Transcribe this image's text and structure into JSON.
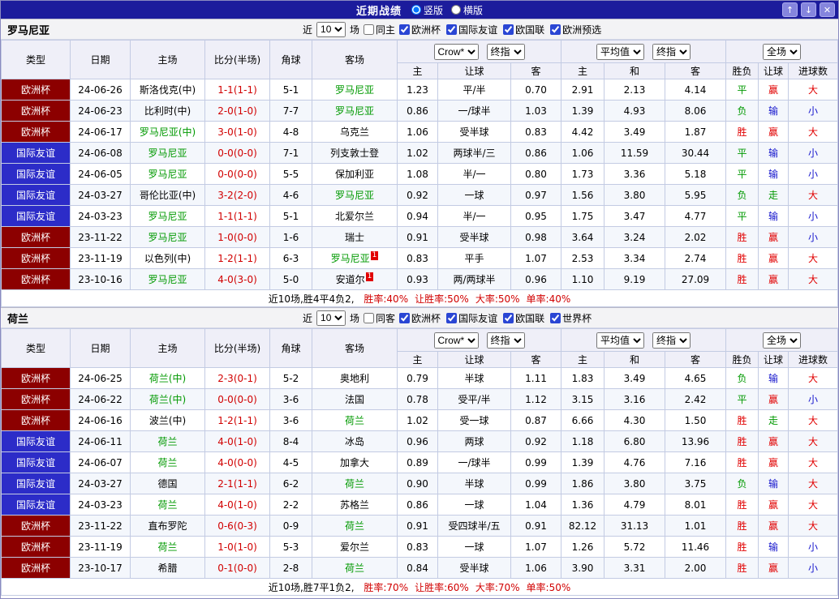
{
  "titlebar": {
    "title": "近期战绩",
    "layout_options": [
      {
        "label": "竖版",
        "selected": true
      },
      {
        "label": "横版",
        "selected": false
      }
    ],
    "buttons": {
      "up": "↑",
      "down": "↓",
      "close": "✕"
    }
  },
  "colors": {
    "titlebar_bg": "#1C1C9C",
    "euro_league_bg": "#8C0000",
    "friendly_league_bg": "#2C2CC8",
    "team_highlight": "#009900",
    "score_red": "#D10000",
    "win_red": "#E10000",
    "draw_green": "#009900",
    "lose_blue": "#1414CC"
  },
  "table_header": {
    "type": "类型",
    "date": "日期",
    "home": "主场",
    "score": "比分(半场)",
    "corners": "角球",
    "away": "客场",
    "bookmaker_select": "Crow*",
    "final_select": "终指",
    "average_select": "平均值",
    "fulltime_select": "全场",
    "sub": {
      "home": "主",
      "handicap": "让球",
      "away": "客",
      "home2": "主",
      "draw": "和",
      "away2": "客",
      "result": "胜负",
      "handicap_result": "让球",
      "goals": "进球数"
    }
  },
  "league_styles": {
    "欧洲杯": "league-euro",
    "国际友谊": "league-friend"
  },
  "result_colors": {
    "胜": "c-red",
    "平": "c-green",
    "负": "c-green",
    "赢": "c-red",
    "输": "c-blue",
    "走": "c-green",
    "大": "c-red",
    "小": "c-blue"
  },
  "teams": [
    {
      "name": "罗马尼亚",
      "filters": {
        "recent": "近",
        "count": "10",
        "matches": "场",
        "venue": {
          "label": "同主",
          "checked": false
        },
        "leagues": [
          {
            "label": "欧洲杯",
            "checked": true
          },
          {
            "label": "国际友谊",
            "checked": true
          },
          {
            "label": "欧国联",
            "checked": true
          },
          {
            "label": "欧洲预选",
            "checked": true
          }
        ]
      },
      "rows": [
        {
          "league": "欧洲杯",
          "date": "24-06-26",
          "home": "斯洛伐克(中)",
          "home_team": false,
          "home_badge": "",
          "score": "1-1(1-1)",
          "corners": "5-1",
          "away": "罗马尼亚",
          "away_team": true,
          "away_badge": "",
          "crow": [
            "1.23",
            "平/半",
            "0.70"
          ],
          "avg": [
            "2.91",
            "2.13",
            "4.14"
          ],
          "results": [
            "平",
            "赢",
            "大"
          ]
        },
        {
          "league": "欧洲杯",
          "date": "24-06-23",
          "home": "比利时(中)",
          "home_team": false,
          "home_badge": "",
          "score": "2-0(1-0)",
          "corners": "7-7",
          "away": "罗马尼亚",
          "away_team": true,
          "away_badge": "",
          "crow": [
            "0.86",
            "一/球半",
            "1.03"
          ],
          "avg": [
            "1.39",
            "4.93",
            "8.06"
          ],
          "results": [
            "负",
            "输",
            "小"
          ]
        },
        {
          "league": "欧洲杯",
          "date": "24-06-17",
          "home": "罗马尼亚(中)",
          "home_team": true,
          "home_badge": "",
          "score": "3-0(1-0)",
          "corners": "4-8",
          "away": "乌克兰",
          "away_team": false,
          "away_badge": "",
          "crow": [
            "1.06",
            "受半球",
            "0.83"
          ],
          "avg": [
            "4.42",
            "3.49",
            "1.87"
          ],
          "results": [
            "胜",
            "赢",
            "大"
          ]
        },
        {
          "league": "国际友谊",
          "date": "24-06-08",
          "home": "罗马尼亚",
          "home_team": true,
          "home_badge": "",
          "score": "0-0(0-0)",
          "corners": "7-1",
          "away": "列支敦士登",
          "away_team": false,
          "away_badge": "",
          "crow": [
            "1.02",
            "两球半/三",
            "0.86"
          ],
          "avg": [
            "1.06",
            "11.59",
            "30.44"
          ],
          "results": [
            "平",
            "输",
            "小"
          ]
        },
        {
          "league": "国际友谊",
          "date": "24-06-05",
          "home": "罗马尼亚",
          "home_team": true,
          "home_badge": "",
          "score": "0-0(0-0)",
          "corners": "5-5",
          "away": "保加利亚",
          "away_team": false,
          "away_badge": "",
          "crow": [
            "1.08",
            "半/一",
            "0.80"
          ],
          "avg": [
            "1.73",
            "3.36",
            "5.18"
          ],
          "results": [
            "平",
            "输",
            "小"
          ]
        },
        {
          "league": "国际友谊",
          "date": "24-03-27",
          "home": "哥伦比亚(中)",
          "home_team": false,
          "home_badge": "",
          "score": "3-2(2-0)",
          "corners": "4-6",
          "away": "罗马尼亚",
          "away_team": true,
          "away_badge": "",
          "crow": [
            "0.92",
            "一球",
            "0.97"
          ],
          "avg": [
            "1.56",
            "3.80",
            "5.95"
          ],
          "results": [
            "负",
            "走",
            "大"
          ]
        },
        {
          "league": "国际友谊",
          "date": "24-03-23",
          "home": "罗马尼亚",
          "home_team": true,
          "home_badge": "",
          "score": "1-1(1-1)",
          "corners": "5-1",
          "away": "北爱尔兰",
          "away_team": false,
          "away_badge": "",
          "crow": [
            "0.94",
            "半/一",
            "0.95"
          ],
          "avg": [
            "1.75",
            "3.47",
            "4.77"
          ],
          "results": [
            "平",
            "输",
            "小"
          ]
        },
        {
          "league": "欧洲杯",
          "date": "23-11-22",
          "home": "罗马尼亚",
          "home_team": true,
          "home_badge": "",
          "score": "1-0(0-0)",
          "corners": "1-6",
          "away": "瑞士",
          "away_team": false,
          "away_badge": "",
          "crow": [
            "0.91",
            "受半球",
            "0.98"
          ],
          "avg": [
            "3.64",
            "3.24",
            "2.02"
          ],
          "results": [
            "胜",
            "赢",
            "小"
          ]
        },
        {
          "league": "欧洲杯",
          "date": "23-11-19",
          "home": "以色列(中)",
          "home_team": false,
          "home_badge": "",
          "score": "1-2(1-1)",
          "corners": "6-3",
          "away": "罗马尼亚",
          "away_team": true,
          "away_badge": "1",
          "crow": [
            "0.83",
            "平手",
            "1.07"
          ],
          "avg": [
            "2.53",
            "3.34",
            "2.74"
          ],
          "results": [
            "胜",
            "赢",
            "大"
          ]
        },
        {
          "league": "欧洲杯",
          "date": "23-10-16",
          "home": "罗马尼亚",
          "home_team": true,
          "home_badge": "",
          "score": "4-0(3-0)",
          "corners": "5-0",
          "away": "安道尔",
          "away_team": false,
          "away_badge": "1",
          "crow": [
            "0.93",
            "两/两球半",
            "0.96"
          ],
          "avg": [
            "1.10",
            "9.19",
            "27.09"
          ],
          "results": [
            "胜",
            "赢",
            "大"
          ]
        }
      ],
      "summary": {
        "prefix": "近10场,胜4平4负2, ",
        "stats": [
          "胜率:40%",
          "让胜率:50%",
          "大率:50%",
          "单率:40%"
        ]
      }
    },
    {
      "name": "荷兰",
      "filters": {
        "recent": "近",
        "count": "10",
        "matches": "场",
        "venue": {
          "label": "同客",
          "checked": false
        },
        "leagues": [
          {
            "label": "欧洲杯",
            "checked": true
          },
          {
            "label": "国际友谊",
            "checked": true
          },
          {
            "label": "欧国联",
            "checked": true
          },
          {
            "label": "世界杯",
            "checked": true
          }
        ]
      },
      "rows": [
        {
          "league": "欧洲杯",
          "date": "24-06-25",
          "home": "荷兰(中)",
          "home_team": true,
          "home_badge": "",
          "score": "2-3(0-1)",
          "corners": "5-2",
          "away": "奥地利",
          "away_team": false,
          "away_badge": "",
          "crow": [
            "0.79",
            "半球",
            "1.11"
          ],
          "avg": [
            "1.83",
            "3.49",
            "4.65"
          ],
          "results": [
            "负",
            "输",
            "大"
          ]
        },
        {
          "league": "欧洲杯",
          "date": "24-06-22",
          "home": "荷兰(中)",
          "home_team": true,
          "home_badge": "",
          "score": "0-0(0-0)",
          "corners": "3-6",
          "away": "法国",
          "away_team": false,
          "away_badge": "",
          "crow": [
            "0.78",
            "受平/半",
            "1.12"
          ],
          "avg": [
            "3.15",
            "3.16",
            "2.42"
          ],
          "results": [
            "平",
            "赢",
            "小"
          ]
        },
        {
          "league": "欧洲杯",
          "date": "24-06-16",
          "home": "波兰(中)",
          "home_team": false,
          "home_badge": "",
          "score": "1-2(1-1)",
          "corners": "3-6",
          "away": "荷兰",
          "away_team": true,
          "away_badge": "",
          "crow": [
            "1.02",
            "受一球",
            "0.87"
          ],
          "avg": [
            "6.66",
            "4.30",
            "1.50"
          ],
          "results": [
            "胜",
            "走",
            "大"
          ]
        },
        {
          "league": "国际友谊",
          "date": "24-06-11",
          "home": "荷兰",
          "home_team": true,
          "home_badge": "",
          "score": "4-0(1-0)",
          "corners": "8-4",
          "away": "冰岛",
          "away_team": false,
          "away_badge": "",
          "crow": [
            "0.96",
            "两球",
            "0.92"
          ],
          "avg": [
            "1.18",
            "6.80",
            "13.96"
          ],
          "results": [
            "胜",
            "赢",
            "大"
          ]
        },
        {
          "league": "国际友谊",
          "date": "24-06-07",
          "home": "荷兰",
          "home_team": true,
          "home_badge": "",
          "score": "4-0(0-0)",
          "corners": "4-5",
          "away": "加拿大",
          "away_team": false,
          "away_badge": "",
          "crow": [
            "0.89",
            "一/球半",
            "0.99"
          ],
          "avg": [
            "1.39",
            "4.76",
            "7.16"
          ],
          "results": [
            "胜",
            "赢",
            "大"
          ]
        },
        {
          "league": "国际友谊",
          "date": "24-03-27",
          "home": "德国",
          "home_team": false,
          "home_badge": "",
          "score": "2-1(1-1)",
          "corners": "6-2",
          "away": "荷兰",
          "away_team": true,
          "away_badge": "",
          "crow": [
            "0.90",
            "半球",
            "0.99"
          ],
          "avg": [
            "1.86",
            "3.80",
            "3.75"
          ],
          "results": [
            "负",
            "输",
            "大"
          ]
        },
        {
          "league": "国际友谊",
          "date": "24-03-23",
          "home": "荷兰",
          "home_team": true,
          "home_badge": "",
          "score": "4-0(1-0)",
          "corners": "2-2",
          "away": "苏格兰",
          "away_team": false,
          "away_badge": "",
          "crow": [
            "0.86",
            "一球",
            "1.04"
          ],
          "avg": [
            "1.36",
            "4.79",
            "8.01"
          ],
          "results": [
            "胜",
            "赢",
            "大"
          ]
        },
        {
          "league": "欧洲杯",
          "date": "23-11-22",
          "home": "直布罗陀",
          "home_team": false,
          "home_badge": "",
          "score": "0-6(0-3)",
          "corners": "0-9",
          "away": "荷兰",
          "away_team": true,
          "away_badge": "",
          "crow": [
            "0.91",
            "受四球半/五",
            "0.91"
          ],
          "avg": [
            "82.12",
            "31.13",
            "1.01"
          ],
          "results": [
            "胜",
            "赢",
            "大"
          ]
        },
        {
          "league": "欧洲杯",
          "date": "23-11-19",
          "home": "荷兰",
          "home_team": true,
          "home_badge": "",
          "score": "1-0(1-0)",
          "corners": "5-3",
          "away": "爱尔兰",
          "away_team": false,
          "away_badge": "",
          "crow": [
            "0.83",
            "一球",
            "1.07"
          ],
          "avg": [
            "1.26",
            "5.72",
            "11.46"
          ],
          "results": [
            "胜",
            "输",
            "小"
          ]
        },
        {
          "league": "欧洲杯",
          "date": "23-10-17",
          "home": "希腊",
          "home_team": false,
          "home_badge": "",
          "score": "0-1(0-0)",
          "corners": "2-8",
          "away": "荷兰",
          "away_team": true,
          "away_badge": "",
          "crow": [
            "0.84",
            "受半球",
            "1.06"
          ],
          "avg": [
            "3.90",
            "3.31",
            "2.00"
          ],
          "results": [
            "胜",
            "赢",
            "小"
          ]
        }
      ],
      "summary": {
        "prefix": "近10场,胜7平1负2, ",
        "stats": [
          "胜率:70%",
          "让胜率:60%",
          "大率:70%",
          "单率:50%"
        ]
      }
    }
  ]
}
